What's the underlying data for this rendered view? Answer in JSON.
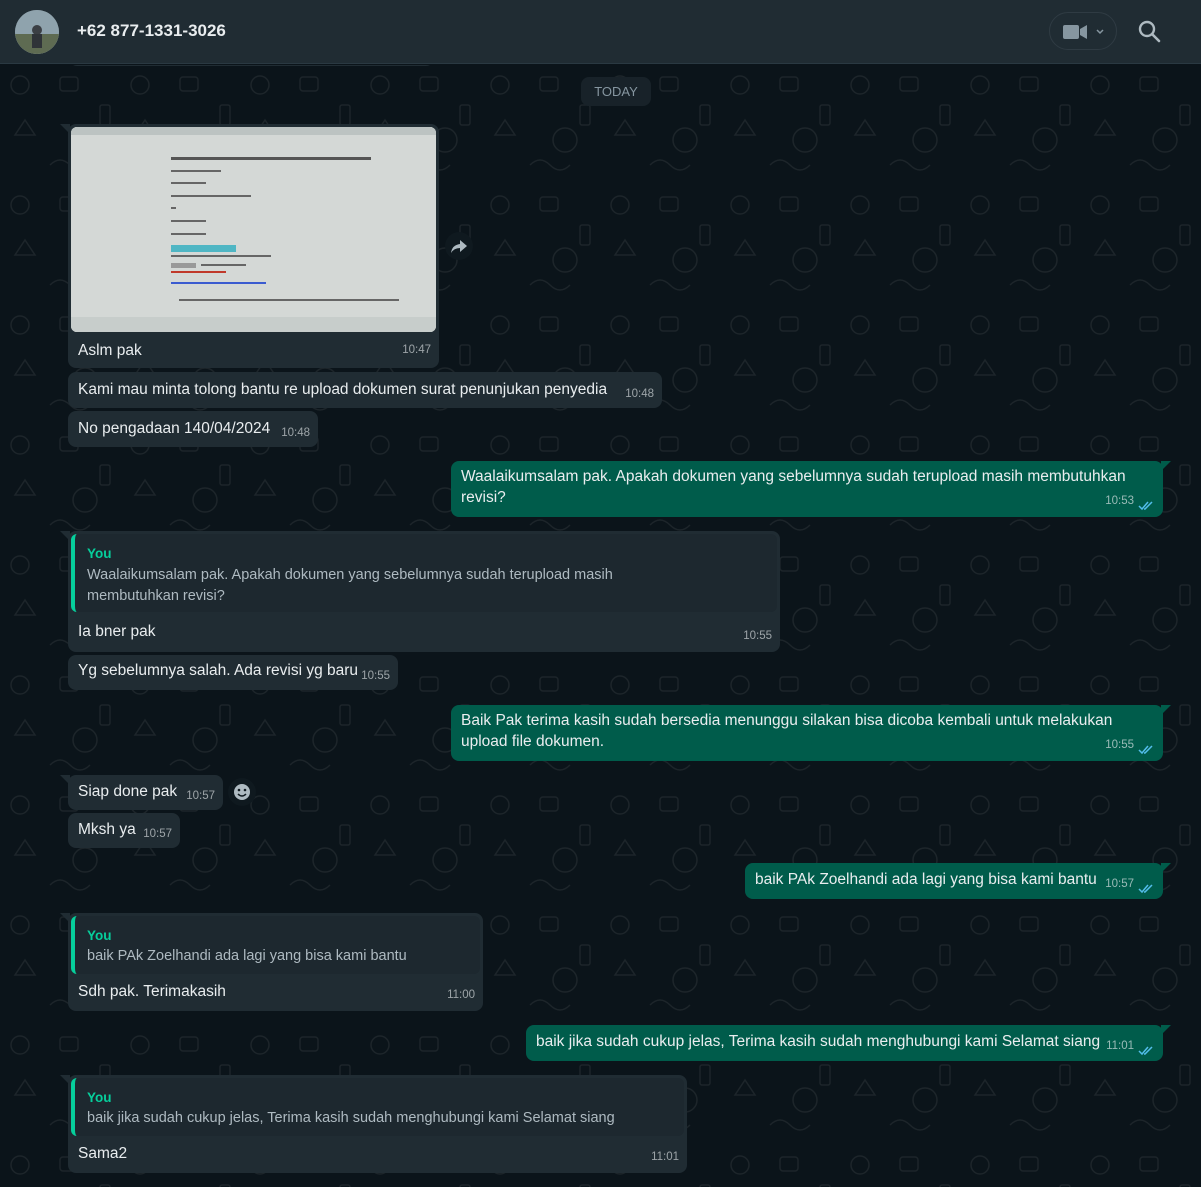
{
  "header": {
    "contact_name": "+62 877-1331-3026",
    "icons": [
      "avatar",
      "video-call-icon",
      "chevron-down-icon",
      "search-icon"
    ]
  },
  "day_label": "TODAY",
  "colors": {
    "incoming": "#202c33",
    "outgoing": "#005c4b",
    "accent": "#06cf9c",
    "ticks": "#53bdeb"
  },
  "messages": [
    {
      "text": "Aslm pak",
      "time": "10:47"
    },
    {
      "text": "Kami mau minta tolong bantu re upload dokumen surat penunjukan penyedia",
      "time": "10:48"
    },
    {
      "text": "No pengadaan 140/04/2024",
      "time": "10:48"
    },
    {
      "text": "Waalaikumsalam pak. Apakah dokumen yang sebelumnya sudah terupload masih membutuhkan revisi?",
      "time": "10:53"
    },
    {
      "quote_name": "You",
      "quote_text": "Waalaikumsalam pak. Apakah dokumen yang sebelumnya sudah terupload masih membutuhkan revisi?",
      "text": "Ia bner pak",
      "time": "10:55"
    },
    {
      "text": "Yg sebelumnya salah. Ada revisi yg baru",
      "time": "10:55"
    },
    {
      "text": "Baik Pak terima kasih sudah bersedia menunggu silakan bisa dicoba kembali untuk melakukan upload file dokumen.",
      "time": "10:55"
    },
    {
      "text": "Siap done pak",
      "time": "10:57"
    },
    {
      "text": "Mksh ya",
      "time": "10:57"
    },
    {
      "text": "baik PAk Zoelhandi ada lagi yang bisa kami bantu",
      "time": "10:57"
    },
    {
      "quote_name": "You",
      "quote_text": "baik PAk Zoelhandi ada lagi yang bisa kami bantu",
      "text": "Sdh pak. Terimakasih",
      "time": "11:00"
    },
    {
      "text": "baik jika sudah cukup jelas, Terima kasih sudah menghubungi kami Selamat siang",
      "time": "11:01"
    },
    {
      "quote_name": "You",
      "quote_text": "baik jika sudah cukup jelas, Terima kasih sudah menghubungi kami Selamat siang",
      "text": "Sama2",
      "time": "11:01"
    }
  ]
}
